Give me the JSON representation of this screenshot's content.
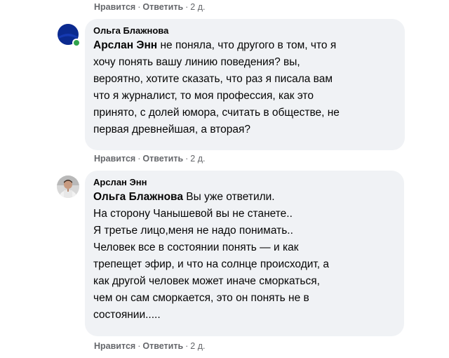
{
  "actions": {
    "like": "Нравится",
    "dot": "·",
    "reply": "Ответить",
    "time": "2 д."
  },
  "comments": [
    {
      "author": "Ольга Блажнова",
      "avatar_icon": "blue-circle-avatar",
      "online": true,
      "mention": "Арслан Энн",
      "lines": [
        " не поняла, что другого в том, что я",
        "хочу понять вашу линию поведения? вы,",
        "вероятно, хотите сказать, что раз я писала вам",
        "что я журналист, то моя профессия, как это",
        "принято, с долей юмора, считать в обществе, не",
        "первая древнейшая, а вторая?"
      ]
    },
    {
      "author": "Арслан Энн",
      "avatar_icon": "person-photo-avatar",
      "online": false,
      "mention": "Ольга Блажнова",
      "lines": [
        " Вы уже ответили.",
        "На сторону Чанышевой вы не станете..",
        "Я третье лицо,меня не надо понимать..",
        "Человек все в состоянии понять — и как",
        "трепещет эфир, и что на солнце происходит, а",
        "как другой человек может иначе сморкаться,",
        "чем он сам сморкается, это он понять не в",
        "состоянии....."
      ]
    }
  ],
  "colors": {
    "bubble": "#f0f2f5",
    "meta": "#65676b",
    "online": "#31a24c",
    "avatar_blue": "#0b2a8f"
  }
}
